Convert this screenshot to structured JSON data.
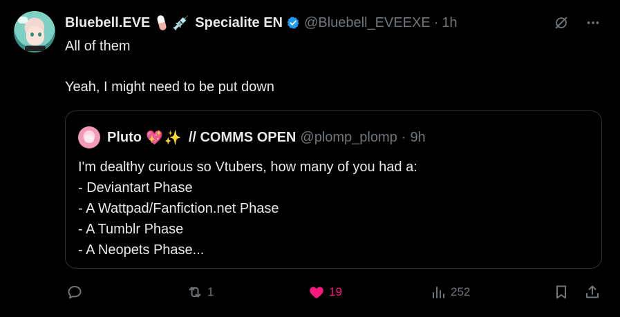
{
  "author": {
    "name": "Bluebell.EVE",
    "emoji_1": "pill-emoji",
    "emoji_2": "💉",
    "suffix": "Specialite EN",
    "handle": "@Bluebell_EVEEXE",
    "separator": "·",
    "time": "1h",
    "verified_color": "#1d9bf0"
  },
  "post": {
    "line1": "All of them",
    "line2": "Yeah, I might need to be put down"
  },
  "quote": {
    "name": "Pluto",
    "emoji_heart": "💖",
    "emoji_sparkles": "✨",
    "comms": "// COMMS OPEN",
    "handle": "@plomp_plomp",
    "separator": "·",
    "time": "9h",
    "lines": [
      "I'm dealthy curious so Vtubers, how many of you had a:",
      "- Deviantart Phase",
      "- A Wattpad/Fanfiction.net Phase",
      "- A Tumblr Phase",
      "- A Neopets Phase..."
    ]
  },
  "actions": {
    "reply_icon": "reply-icon",
    "retweet_count": "1",
    "like_count": "19",
    "like_color": "#f91880",
    "views_count": "252",
    "bookmark_icon": "bookmark-icon",
    "share_icon": "share-icon"
  },
  "top_icons": [
    "grok-icon",
    "more-icon"
  ]
}
